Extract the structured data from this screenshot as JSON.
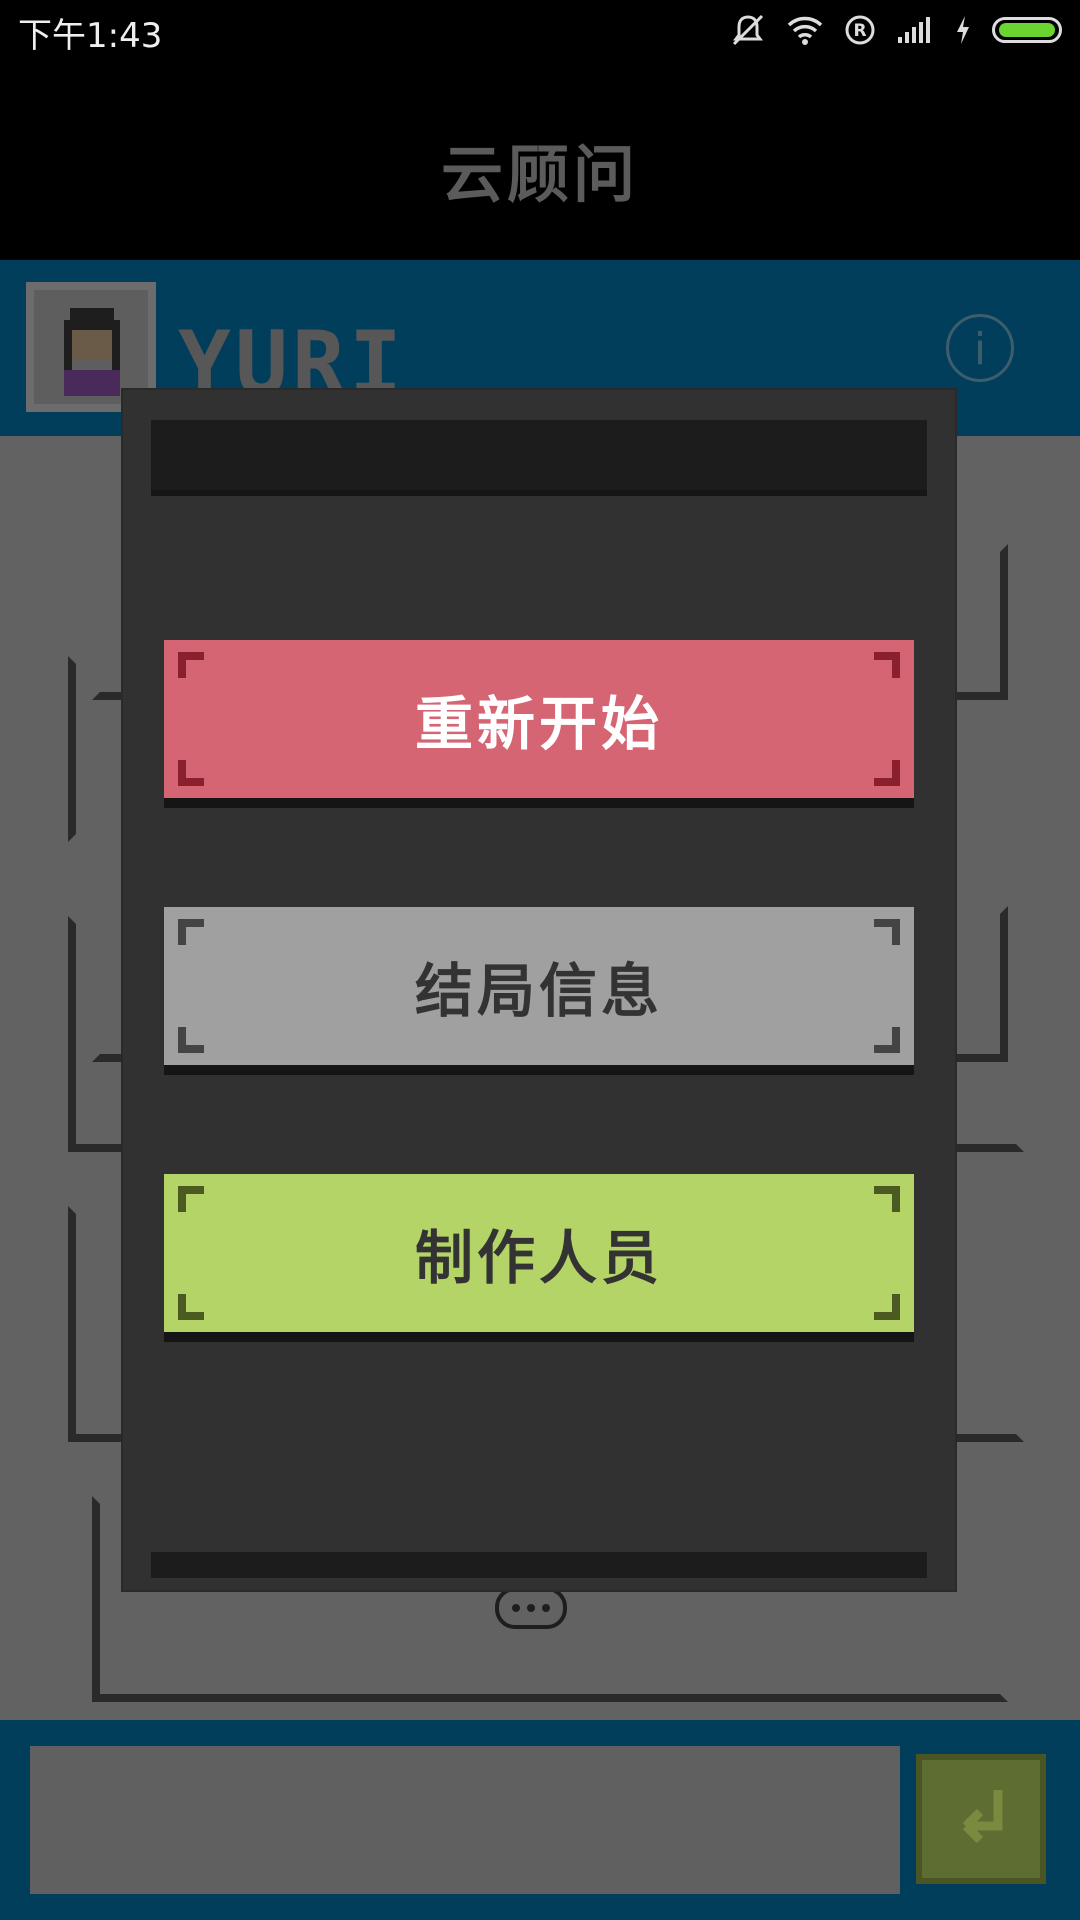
{
  "status_bar": {
    "time": "下午1:43"
  },
  "title_bar": {
    "title": "云顾问"
  },
  "contact": {
    "name": "YURI",
    "info_icon": "i"
  },
  "input": {
    "placeholder": ""
  },
  "dialog": {
    "buttons": [
      {
        "label": "重新开始",
        "color": "#d66574",
        "text_color": "#ffffff",
        "corner_color": "#8a1f2e"
      },
      {
        "label": "结局信息",
        "color": "#a0a0a0",
        "text_color": "#333333",
        "corner_color": "#444444"
      },
      {
        "label": "制作人员",
        "color": "#b4d468",
        "text_color": "#333333",
        "corner_color": "#4a5a20"
      }
    ]
  },
  "icons": [
    "mute-icon",
    "wifi-icon",
    "roaming-icon",
    "signal-icon",
    "charging-icon",
    "battery-icon",
    "info-icon",
    "send-icon",
    "typing-icon"
  ]
}
